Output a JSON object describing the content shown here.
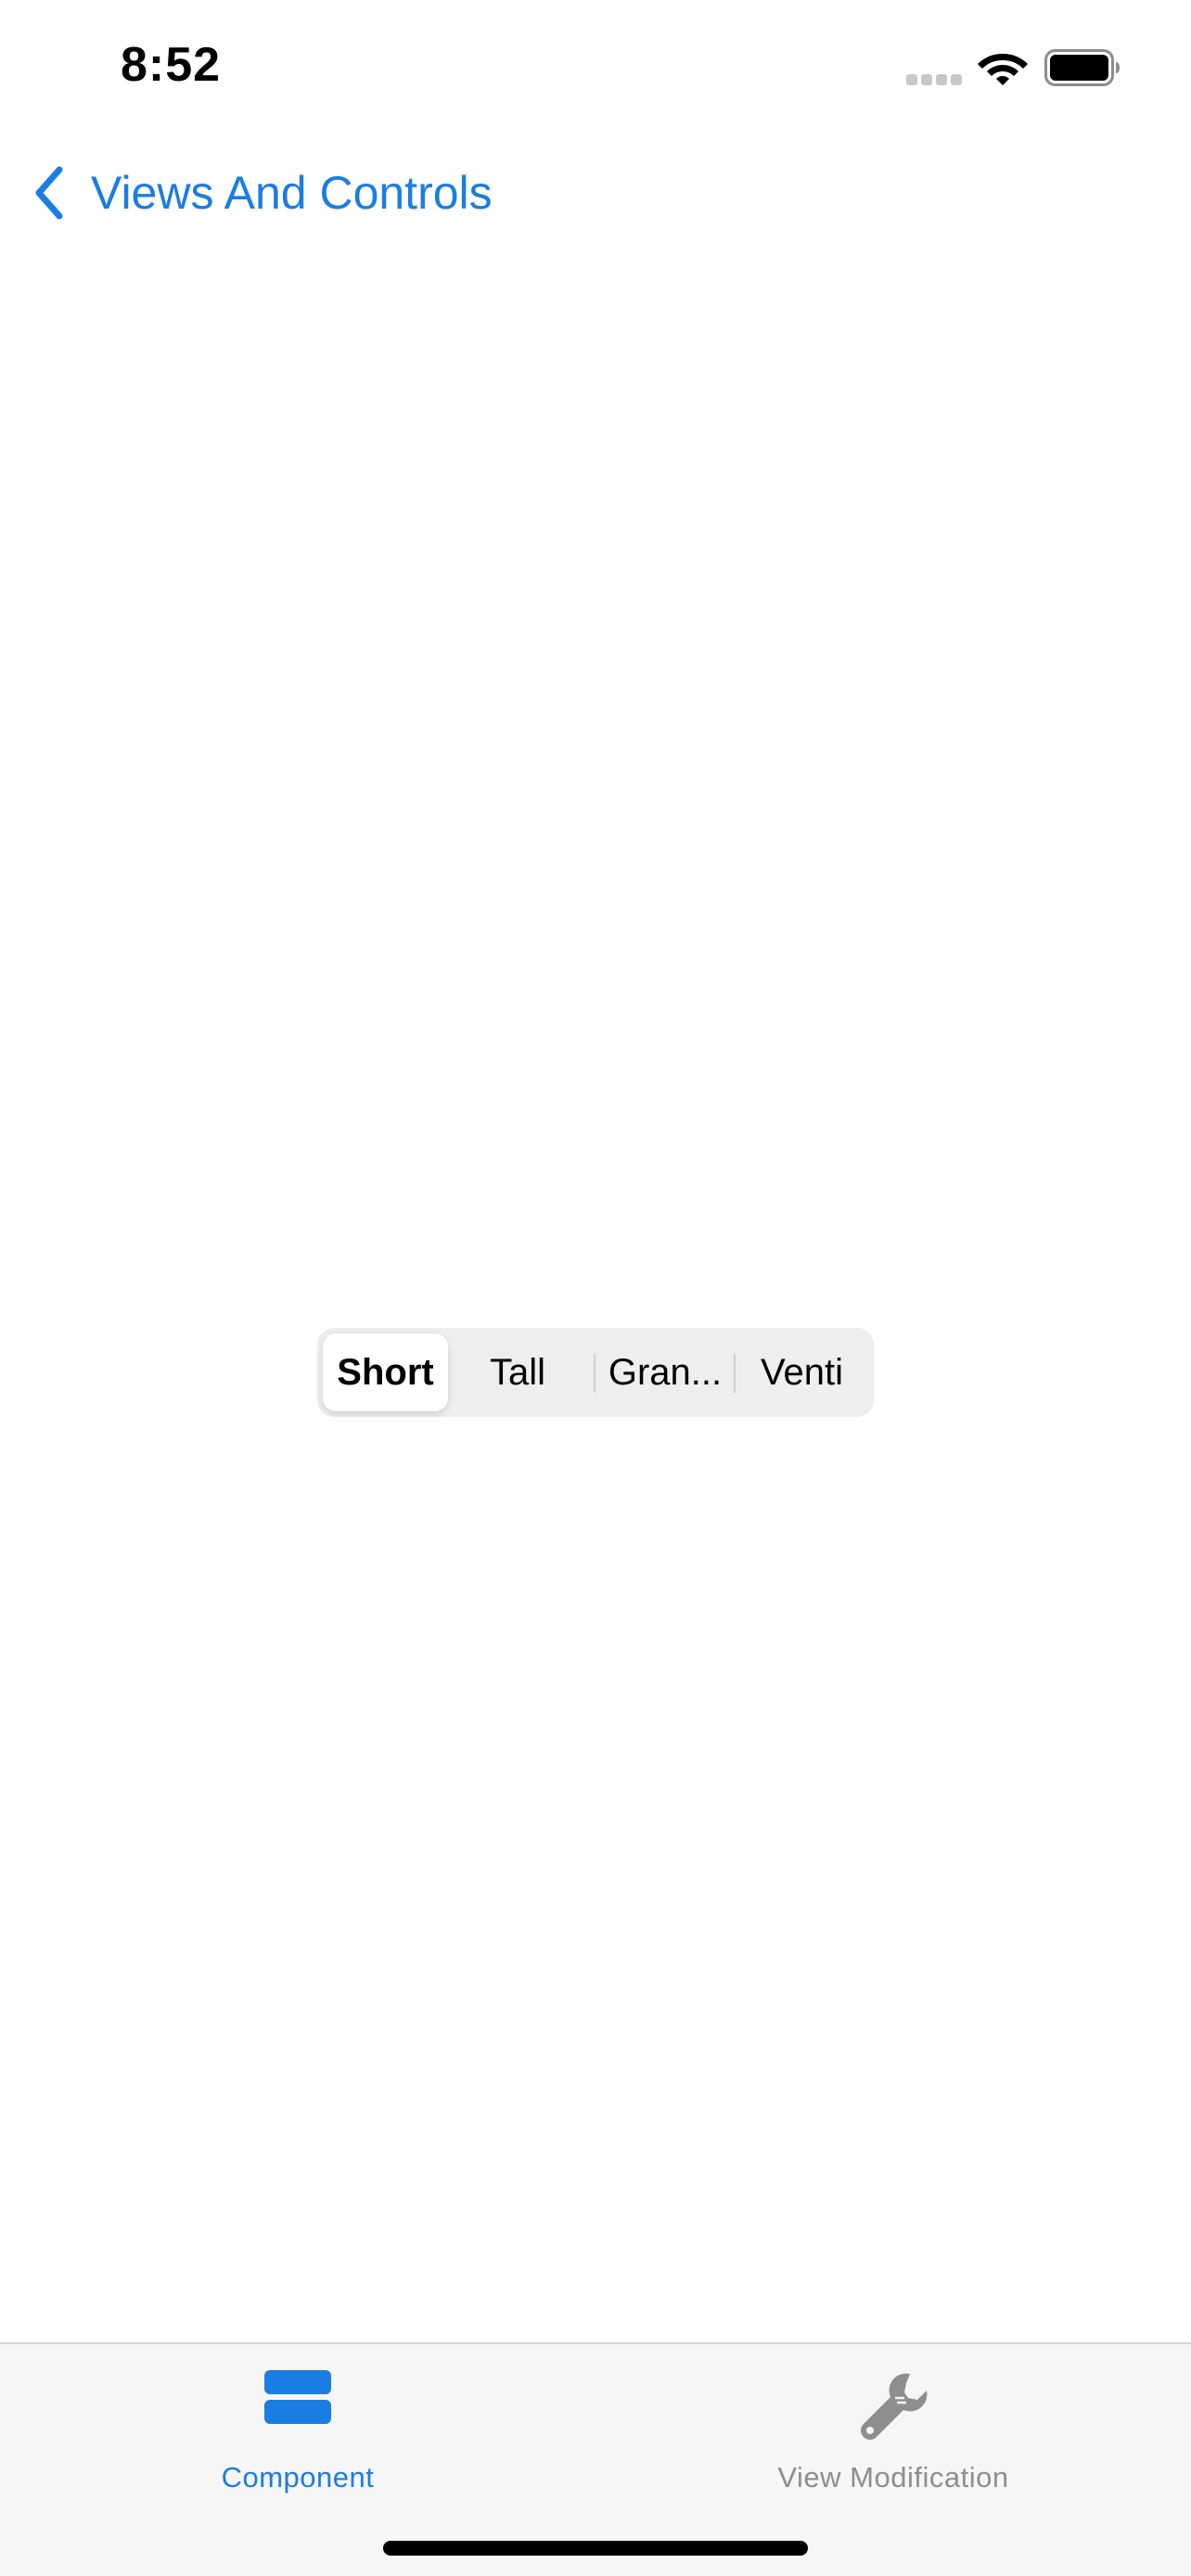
{
  "status_bar": {
    "time": "8:52"
  },
  "nav": {
    "back_label": "Views And Controls"
  },
  "segmented_control": {
    "selected_index": 0,
    "segments": [
      "Short",
      "Tall",
      "Gran...",
      "Venti"
    ]
  },
  "tab_bar": {
    "items": [
      {
        "label": "Component",
        "icon": "stacked-rectangles-icon",
        "active": true
      },
      {
        "label": "View Modification",
        "icon": "wrench-icon",
        "active": false
      }
    ]
  },
  "colors": {
    "accent": "#1a7de3",
    "tab_active": "#1a7de3",
    "tab_inactive": "#8e8e8e",
    "segment_track": "#eeeeef",
    "tab_bar_bg": "#f6f6f6"
  }
}
